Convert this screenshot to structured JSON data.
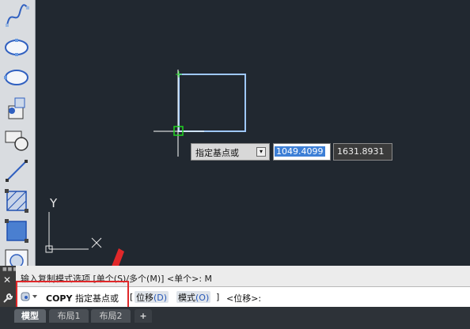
{
  "viewport": {
    "ucs_y_label": "Y",
    "crosshair_color": "#ffffff",
    "rectangle_color": "#9fc8ff",
    "snap_marker_color": "#1fd51f"
  },
  "dynamic_input": {
    "prompt": "指定基点或",
    "dropdown_glyph": "▾",
    "x_value": "1049.4099",
    "y_value": "1631.8931"
  },
  "command": {
    "history": "输入复制模式选项 [单个(S)/多个(M)] <单个>: M",
    "prompt_name": "COPY",
    "prompt_text": "指定基点或",
    "open_bracket": "[",
    "option1_label": "位移",
    "option1_key": "(D)",
    "option2_label": "模式",
    "option2_key": "(O)",
    "close_bracket": "]",
    "default": "<位移>:",
    "close_glyph": "✕"
  },
  "layout_tabs": {
    "model": "模型",
    "layout1": "布局1",
    "layout2": "布局2",
    "add": "+"
  },
  "toolbar_icons": [
    "spline-icon",
    "ellipse-icon",
    "ellipse-arc-icon",
    "insert-block-icon",
    "make-block-icon",
    "point-line-icon",
    "hatch-icon",
    "gradient-icon",
    "region-icon"
  ],
  "accent": {
    "highlight_box": "#e0282a",
    "arrow": "#e0282a"
  }
}
